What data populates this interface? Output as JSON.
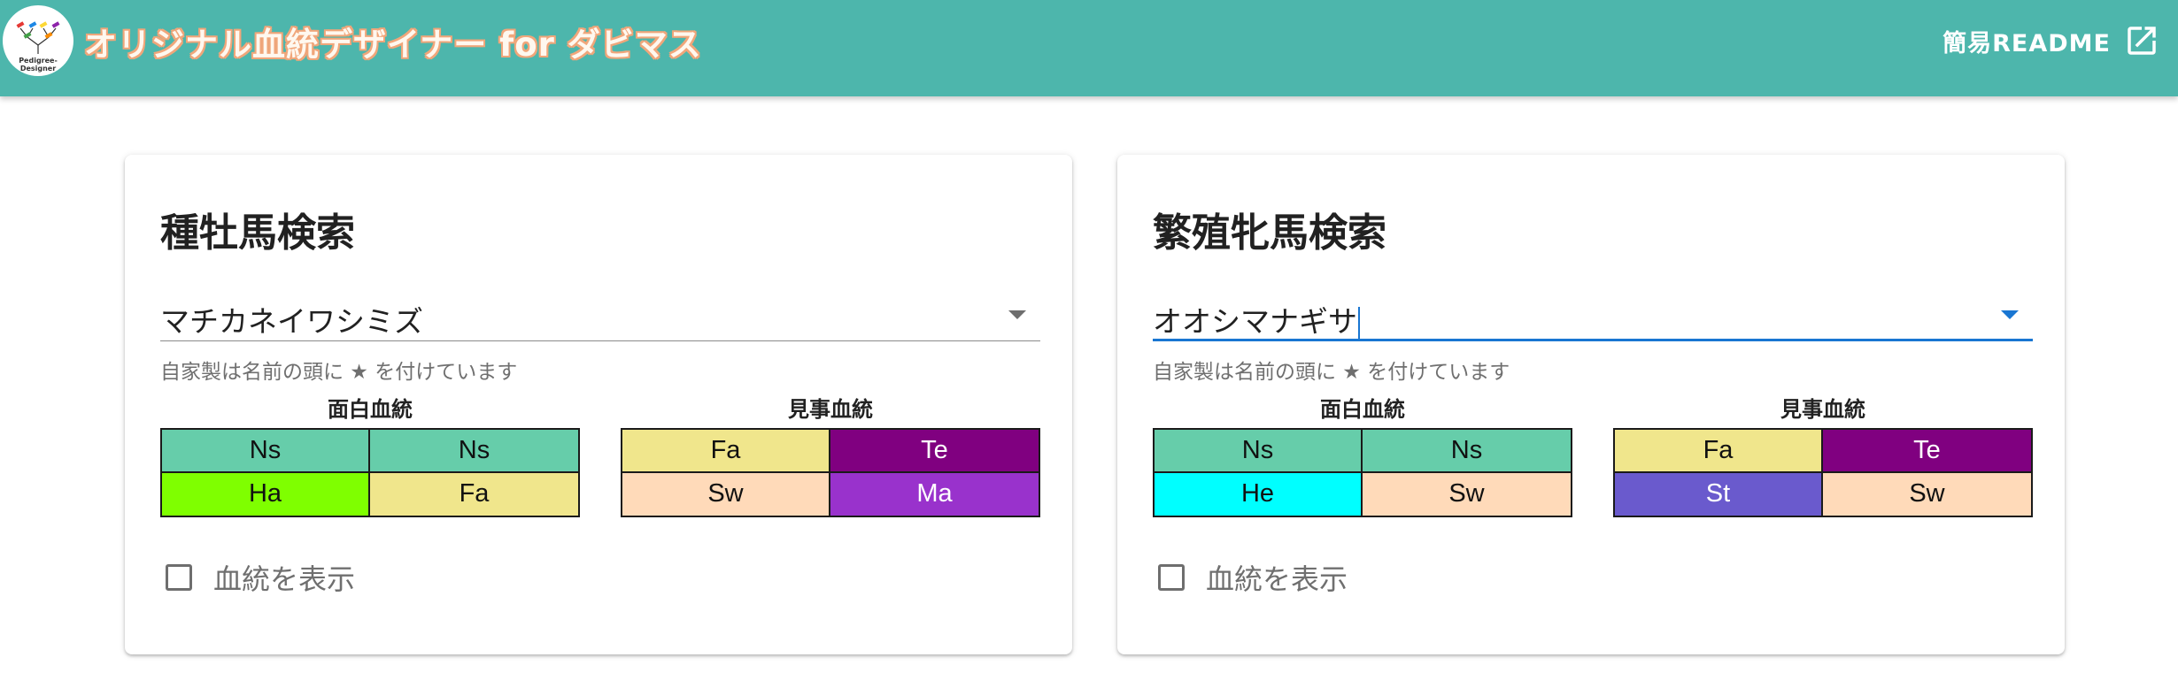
{
  "header": {
    "app_title": "オリジナル血統デザイナー for ダビマス",
    "logo_text_line1": "Pedigree-",
    "logo_text_line2": "Designer",
    "readme_label": "簡易README",
    "readme_icon": "open-in-new-icon",
    "bar_color": "#4db6ac"
  },
  "stallion": {
    "title": "種牡馬検索",
    "selected": "マチカネイワシミズ",
    "hint": "自家製は名前の頭に ★ を付けています",
    "interesting": {
      "label": "面白血統",
      "cells": [
        {
          "text": "Ns",
          "bg": "#66cdaa",
          "fg": "#111111"
        },
        {
          "text": "Ns",
          "bg": "#66cdaa",
          "fg": "#111111"
        },
        {
          "text": "Ha",
          "bg": "#7fff00",
          "fg": "#111111"
        },
        {
          "text": "Fa",
          "bg": "#f0e68c",
          "fg": "#111111"
        }
      ]
    },
    "splendid": {
      "label": "見事血統",
      "cells": [
        {
          "text": "Fa",
          "bg": "#f0e68c",
          "fg": "#111111"
        },
        {
          "text": "Te",
          "bg": "#800080",
          "fg": "#ffffff"
        },
        {
          "text": "Sw",
          "bg": "#ffdab9",
          "fg": "#111111"
        },
        {
          "text": "Ma",
          "bg": "#9932cc",
          "fg": "#ffffff"
        }
      ]
    },
    "show_pedigree_label": "血統を表示",
    "show_pedigree_checked": false
  },
  "mare": {
    "title": "繁殖牝馬検索",
    "selected": "オオシマナギサ",
    "hint": "自家製は名前の頭に ★ を付けています",
    "interesting": {
      "label": "面白血統",
      "cells": [
        {
          "text": "Ns",
          "bg": "#66cdaa",
          "fg": "#111111"
        },
        {
          "text": "Ns",
          "bg": "#66cdaa",
          "fg": "#111111"
        },
        {
          "text": "He",
          "bg": "#00ffff",
          "fg": "#111111"
        },
        {
          "text": "Sw",
          "bg": "#ffdab9",
          "fg": "#111111"
        }
      ]
    },
    "splendid": {
      "label": "見事血統",
      "cells": [
        {
          "text": "Fa",
          "bg": "#f0e68c",
          "fg": "#111111"
        },
        {
          "text": "Te",
          "bg": "#800080",
          "fg": "#ffffff"
        },
        {
          "text": "St",
          "bg": "#6a5acd",
          "fg": "#ffffff"
        },
        {
          "text": "Sw",
          "bg": "#ffdab9",
          "fg": "#111111"
        }
      ]
    },
    "show_pedigree_label": "血統を表示",
    "show_pedigree_checked": false
  }
}
